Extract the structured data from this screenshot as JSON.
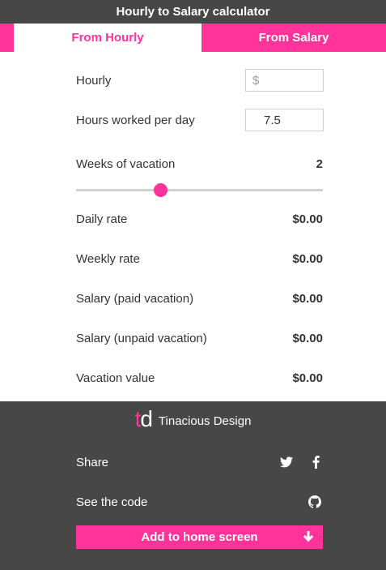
{
  "header": {
    "title": "Hourly to Salary calculator"
  },
  "tabs": [
    {
      "label": "From Hourly",
      "active": true
    },
    {
      "label": "From Salary",
      "active": false
    }
  ],
  "form": {
    "hourly": {
      "label": "Hourly",
      "value": "",
      "placeholder": "$"
    },
    "hours_per_day": {
      "label": "Hours worked per day",
      "value": "7.5"
    },
    "weeks_vacation": {
      "label": "Weeks of vacation",
      "value": "2",
      "slider_fraction": 0.34
    }
  },
  "results": [
    {
      "label": "Daily rate",
      "value": "$0.00"
    },
    {
      "label": "Weekly rate",
      "value": "$0.00"
    },
    {
      "label": "Salary (paid vacation)",
      "value": "$0.00"
    },
    {
      "label": "Salary (unpaid vacation)",
      "value": "$0.00"
    },
    {
      "label": "Vacation value",
      "value": "$0.00"
    }
  ],
  "footer": {
    "brand_logo_t": "t",
    "brand_logo_d": "d",
    "brand_name": "Tinacious Design",
    "share_label": "Share",
    "code_label": "See the code",
    "cta_label": "Add to home screen"
  },
  "colors": {
    "accent": "#ff3399",
    "dark": "#474747"
  }
}
